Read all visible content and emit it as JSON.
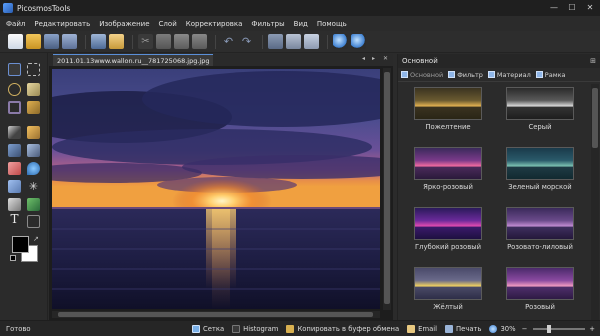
{
  "window": {
    "title": "PicosmosTools"
  },
  "menu": [
    "Файл",
    "Редактировать",
    "Изображение",
    "Слой",
    "Корректировка",
    "Фильтры",
    "Вид",
    "Помощь"
  ],
  "toolbar": {
    "icons": [
      "new-file-icon",
      "open-folder-icon",
      "save-icon",
      "save-as-icon",
      "print-icon",
      "email-icon",
      "cut-icon",
      "copy-icon",
      "paste-icon",
      "delete-icon",
      "undo-icon",
      "redo-icon",
      "crop-icon",
      "flip-icon",
      "rotate-icon",
      "zoom-in-icon",
      "zoom-out-icon"
    ]
  },
  "document": {
    "tab_label": "2011.01.13www.wallon.ru__781725068.jpg.jpg"
  },
  "panel": {
    "title": "Основной",
    "tabs": [
      "Основной",
      "Фильтр",
      "Материал",
      "Рамка"
    ],
    "filters": [
      {
        "label": "Пожелтение"
      },
      {
        "label": "Серый"
      },
      {
        "label": "Ярко-розовый"
      },
      {
        "label": "Зеленый морской"
      },
      {
        "label": "Глубокий розовый"
      },
      {
        "label": "Розовато-лиловый"
      },
      {
        "label": "Жёлтый"
      },
      {
        "label": "Розовый"
      }
    ]
  },
  "status": {
    "ready": "Готово",
    "grid": "Сетка",
    "histogram": "Histogram",
    "copy": "Копировать в буфер обмена",
    "email": "Email",
    "print": "Печать",
    "zoom": "30%",
    "zoom_fraction": 0.3
  },
  "colors": {
    "accent": "#5a8fd8",
    "background": "#2b2b2b",
    "foreground_swatch": "#000000",
    "background_swatch": "#ffffff"
  }
}
